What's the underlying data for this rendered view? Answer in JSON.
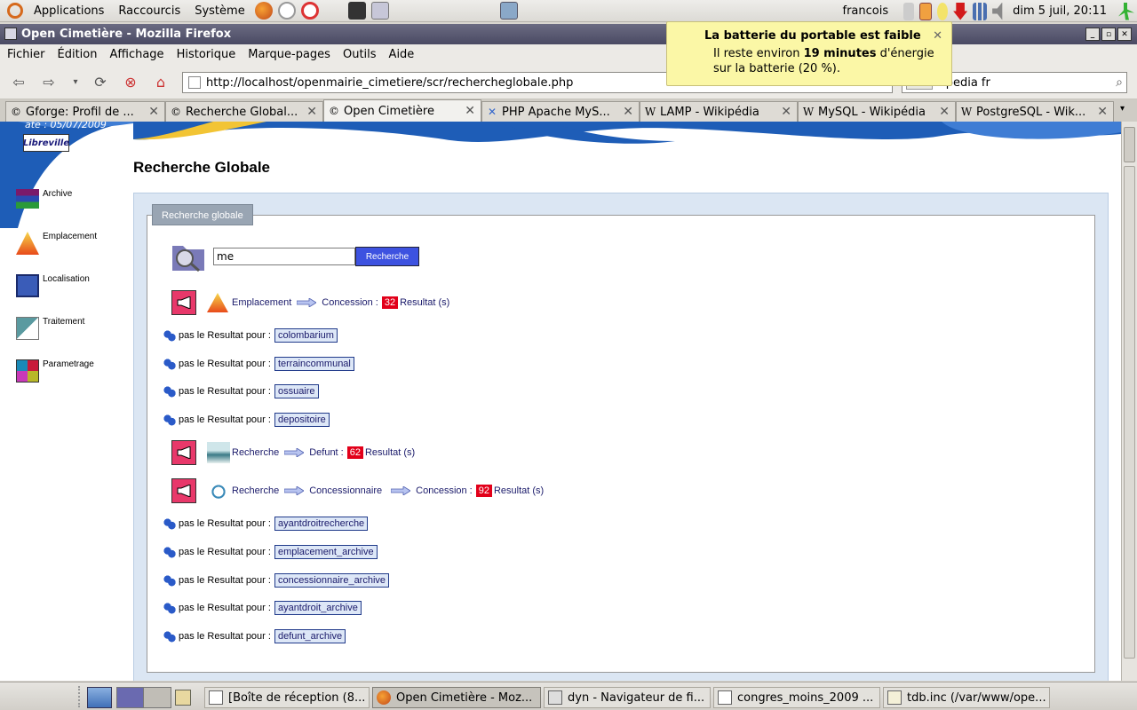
{
  "top_panel": {
    "menus": [
      "Applications",
      "Raccourcis",
      "Système"
    ],
    "user": "francois",
    "clock": "dim  5 juil, 20:11"
  },
  "window": {
    "title": "Open Cimetière - Mozilla Firefox"
  },
  "menubar": [
    "Fichier",
    "Édition",
    "Affichage",
    "Historique",
    "Marque-pages",
    "Outils",
    "Aide"
  ],
  "navbar": {
    "url": "http://localhost/openmairie_cimetiere/scr/rechercheglobale.php",
    "search_value": "tipedia fr"
  },
  "tabs": [
    {
      "label": "Gforge: Profil de ...",
      "fav": "©"
    },
    {
      "label": "Recherche Global...",
      "fav": "©"
    },
    {
      "label": "Open Cimetière",
      "fav": "©"
    },
    {
      "label": "PHP Apache MyS...",
      "fav": "✕"
    },
    {
      "label": "LAMP - Wikipédia",
      "fav": "W"
    },
    {
      "label": "MySQL - Wikipédia",
      "fav": "W"
    },
    {
      "label": "PostgreSQL - Wik...",
      "fav": "W"
    }
  ],
  "notification": {
    "title": "La batterie du portable est faible",
    "body_pre": "Il reste environ ",
    "body_bold": "19 minutes",
    "body_post": " d'énergie sur la batterie (20 %)."
  },
  "page": {
    "date_text": "ate : 05/07/2009",
    "city": "Libreville",
    "title": "Recherche Globale",
    "side_menu": [
      "Archive",
      "Emplacement",
      "Localisation",
      "Traitement",
      "Parametrage"
    ],
    "legend": "Recherche globale",
    "search_value": "me",
    "search_button": "Recherche",
    "result_rows": [
      {
        "a": "Emplacement",
        "b": "Concession :",
        "count": "32",
        "suffix": "Resultat (s)"
      },
      {
        "a": "Recherche",
        "b": "Defunt :",
        "count": "62",
        "suffix": "Resultat (s)"
      },
      {
        "a": "Recherche",
        "b": "Concessionnaire",
        "c": "Concession :",
        "count": "92",
        "suffix": "Resultat (s)"
      }
    ],
    "no_result_prefix": "pas le Resultat pour :",
    "no_result_group1": [
      "colombarium",
      "terraincommunal",
      "ossuaire",
      "depositoire"
    ],
    "no_result_group2": [
      "ayantdroitrecherche",
      "emplacement_archive",
      "concessionnaire_archive",
      "ayantdroit_archive",
      "defunt_archive"
    ]
  },
  "taskbar": [
    {
      "label": "[Boîte de réception (8..."
    },
    {
      "label": "Open Cimetière - Moz..."
    },
    {
      "label": "dyn - Navigateur de fi..."
    },
    {
      "label": "congres_moins_2009 ..."
    },
    {
      "label": "tdb.inc (/var/www/ope..."
    }
  ],
  "colors": {
    "accent_blue": "#3d52e0",
    "count_red": "#e2001a",
    "megaphone_pink": "#e8386a",
    "title_bar": "#4a4a63"
  }
}
